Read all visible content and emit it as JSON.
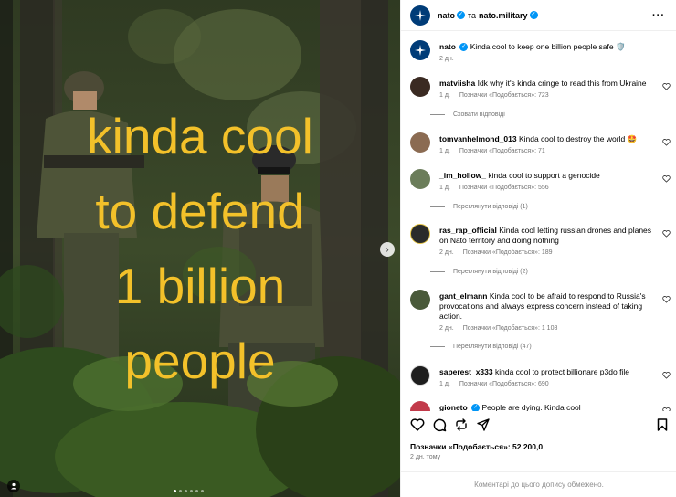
{
  "post": {
    "overlay_lines": [
      "kinda cool",
      "to defend",
      "1 billion",
      "people"
    ],
    "slide_count": 6,
    "active_slide": 0
  },
  "header": {
    "account": "nato",
    "joiner": "та",
    "collab": "nato.military"
  },
  "caption": {
    "user": "nato",
    "text": "Kinda cool to keep one billion people safe 🛡️",
    "time": "2 дн."
  },
  "comments": [
    {
      "user": "matviisha",
      "text": "Idk why it's kinda cringe to read this from Ukraine",
      "time": "1 д.",
      "likes": "Позначки «Подобається»: 723",
      "avatar_color": "#3a2a22"
    },
    {
      "user": "tomvanhelmond_013",
      "text": "Kinda cool to destroy the world 🤩",
      "time": "1 д.",
      "likes": "Позначки «Подобається»: 71",
      "avatar_color": "#8b6b52"
    },
    {
      "user": "_im_hollow_",
      "text": "kinda cool to support a genocide",
      "time": "1 д.",
      "likes": "Позначки «Подобається»: 556",
      "avatar_color": "#6b7d5a"
    },
    {
      "user": "ras_rap_official",
      "text": "Kinda cool letting russian drones and planes on Nato territory and doing nothing",
      "time": "2 дн.",
      "likes": "Позначки «Подобається»: 189",
      "avatar_color": "#2b2b2b"
    },
    {
      "user": "gant_elmann",
      "text": "Kinda cool to be afraid to respond to Russia's provocations and always express concern instead of taking action.",
      "time": "2 дн.",
      "likes": "Позначки «Подобається»: 1 108",
      "avatar_color": "#4a5a3a"
    },
    {
      "user": "saperest_x333",
      "text": "kinda cool to protect billionare p3do file",
      "time": "1 д.",
      "likes": "Позначки «Подобається»: 690",
      "avatar_color": "#1e1e1e"
    },
    {
      "user": "gioneto",
      "text": "People are dying. Kinda cool",
      "time": "",
      "likes": "",
      "avatar_color": "#c23a4a"
    }
  ],
  "replies": {
    "hide": "Сховати відповіді",
    "view_1": "Переглянути відповіді (1)",
    "view_2": "Переглянути відповіді (2)",
    "view_47": "Переглянути відповіді (47)"
  },
  "stats": {
    "likes": "Позначки «Подобається»: 52 200,0",
    "date": "2 дн. тому"
  },
  "footer": {
    "text": "Коментарі до цього допису обмежено."
  },
  "colors": {
    "overlay_text": "#f3c12a",
    "verified": "#0095f6",
    "nato_blue": "#003c78"
  }
}
